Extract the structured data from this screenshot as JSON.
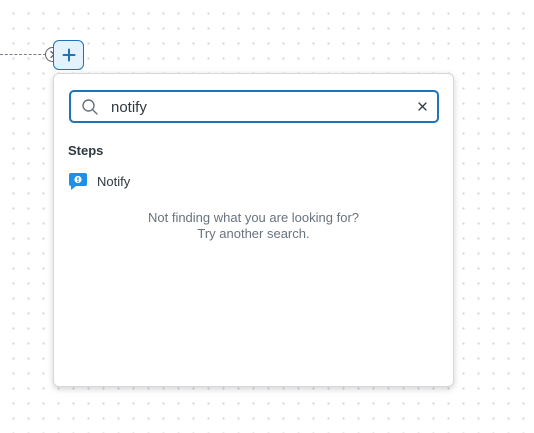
{
  "canvas": {
    "add_step_icon": "plus-icon",
    "connector_icon": "chevron-right-icon"
  },
  "picker": {
    "search": {
      "value": "notify",
      "placeholder": "Search",
      "search_icon": "search-icon",
      "clear_icon": "close-icon"
    },
    "section_title": "Steps",
    "results": [
      {
        "label": "Notify",
        "icon": "notify-icon"
      }
    ],
    "empty_message": {
      "line1": "Not finding what you are looking for?",
      "line2": "Try another search."
    }
  },
  "colors": {
    "accent": "#1f73b7",
    "accent_light": "#e3f2fc",
    "notify_blue": "#1f8fe8",
    "text": "#2f3941",
    "muted_text": "#68737d"
  }
}
